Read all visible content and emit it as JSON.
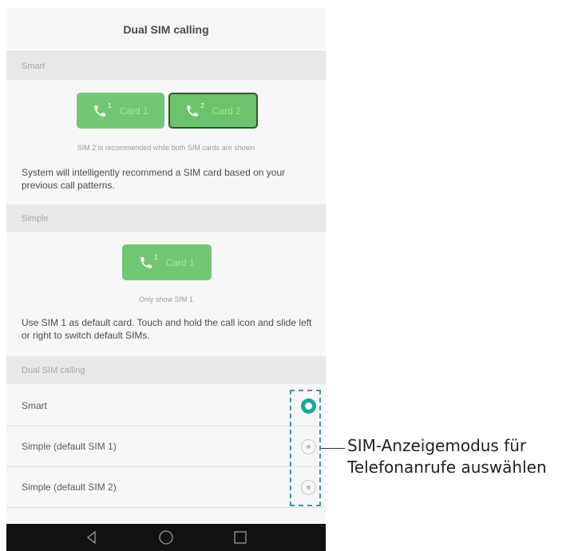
{
  "header": {
    "title": "Dual SIM calling"
  },
  "smart_section": {
    "header": "Smart",
    "cards": [
      {
        "label": "Card 1",
        "sim_number": "1",
        "selected": false
      },
      {
        "label": "Card 2",
        "sim_number": "2",
        "selected": true
      }
    ],
    "caption": "SIM 2 is recommended while both SIM cards are shown",
    "description": "System will intelligently recommend a SIM card based on your previous call patterns."
  },
  "simple_section": {
    "header": "Simple",
    "card": {
      "label": "Card 1",
      "sim_number": "1"
    },
    "caption": "Only show SIM 1",
    "description": "Use SIM 1 as default card. Touch and hold the call icon and slide left or right to switch default SIMs."
  },
  "options_section": {
    "header": "Dual SIM calling",
    "options": [
      {
        "label": "Smart",
        "selected": true
      },
      {
        "label": "Simple (default SIM 1)",
        "selected": false
      },
      {
        "label": "Simple (default SIM 2)",
        "selected": false
      }
    ]
  },
  "navbar": {
    "icons": [
      "back-icon",
      "home-icon",
      "recents-icon"
    ]
  },
  "annotation": {
    "line1": "SIM-Anzeigemodus für",
    "line2": "Telefonanrufe auswählen"
  },
  "colors": {
    "accent": "#1aa59a",
    "card_green": "#72c872",
    "callout_dash": "#3f94a8"
  }
}
